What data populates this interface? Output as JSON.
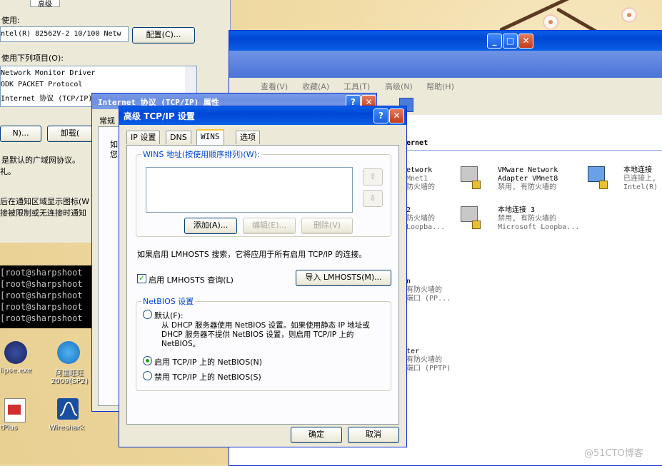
{
  "background_window": {
    "tab_partial": "高级",
    "connect_using_label": "使用:",
    "adapter_name": "ntel(R) 82562V-2 10/100 Netw",
    "configure_button": "配置(C)...",
    "items_label": "使用下列项目(O):",
    "items": [
      "Network Monitor Driver",
      "ODK PACKET Protocol",
      "Internet 协议 (TCP/IP)"
    ],
    "install_button": "N)...",
    "uninstall_button": "卸载(",
    "description": "是默认的广域网协议。",
    "description2": "礼。",
    "notify_text": "后在通知区域显示图标(W",
    "limited_text": "接被限制或无连接时通知"
  },
  "terminal": {
    "lines": [
      "[root@sharpshoot",
      "[root@sharpshoot",
      "[root@sharpshoot",
      "[root@sharpshoot",
      "[root@sharpshoot"
    ]
  },
  "desktop_icons": [
    {
      "label": "lipse.exe",
      "icon": "eclipse-icon"
    },
    {
      "label": "阿里旺旺\n2009(SP2)",
      "icon": "aliwangwang-icon"
    },
    {
      "label": "tPlus",
      "icon": "editplus-icon"
    },
    {
      "label": "Wireshark",
      "icon": "wireshark-icon"
    }
  ],
  "explorer": {
    "menu": [
      "查看(V)",
      "收藏(A)",
      "工具(T)",
      "高级(N)",
      "帮助(H)"
    ],
    "section_header": "ernet",
    "connections": [
      {
        "name": "etwork",
        "line2": "Mnet1",
        "line3": "防火墙的"
      },
      {
        "name": "VMware Network Adapter VMnet8",
        "line2": "禁用, 有防火墙的",
        "line3": ""
      },
      {
        "name": "本地连接",
        "line2": "已连接上,",
        "line3": "Intel(R)"
      },
      {
        "name": "2",
        "line2": "防火墙的",
        "line3": "Loopba..."
      },
      {
        "name": "本地连接 3",
        "line2": "禁用, 有防火墙的",
        "line3": "Microsoft Loopba..."
      },
      {
        "name": "n",
        "line2": "有防火墙的",
        "line3": "端口 (PP..."
      },
      {
        "name": "ter",
        "line2": "有防火墙的",
        "line3": "端口 (PPTP)"
      }
    ]
  },
  "tcpip_props": {
    "title": "Internet 协议 (TCP/IP) 属性",
    "tab": "常规",
    "text1": "如",
    "text2": "您"
  },
  "dialog": {
    "title": "高级 TCP/IP 设置",
    "help_btn": "?",
    "close_btn": "✕",
    "tabs": [
      "IP 设置",
      "DNS",
      "WINS",
      "选项"
    ],
    "active_tab": "WINS",
    "wins_group_label": "WINS 地址(按使用顺序排列)(W):",
    "add_button": "添加(A)...",
    "edit_button": "编辑(E)...",
    "remove_button": "删除(V)",
    "lmhosts_info": "如果启用 LMHOSTS 搜索，它将应用于所有启用 TCP/IP 的连接。",
    "enable_lmhosts": "启用 LMHOSTS 查询(L)",
    "enable_lmhosts_checked": true,
    "import_button": "导入 LMHOSTS(M)...",
    "netbios_label": "NetBIOS 设置",
    "opt_default": "默认(F):",
    "opt_default_desc": "从 DHCP 服务器使用 NetBIOS 设置。如果使用静态 IP 地址或 DHCP 服务器不提供 NetBIOS 设置，则启用 TCP/IP 上的 NetBIOS。",
    "opt_enable": "启用 TCP/IP 上的 NetBIOS(N)",
    "opt_disable": "禁用 TCP/IP 上的 NetBIOS(S)",
    "selected_option": "enable",
    "ok_button": "确定",
    "cancel_button": "取消"
  },
  "watermark": "@51CTO博客",
  "colors": {
    "xp_blue": "#0a5fe6",
    "dialog_bg": "#ece9d8",
    "group_label": "#0046d5"
  }
}
